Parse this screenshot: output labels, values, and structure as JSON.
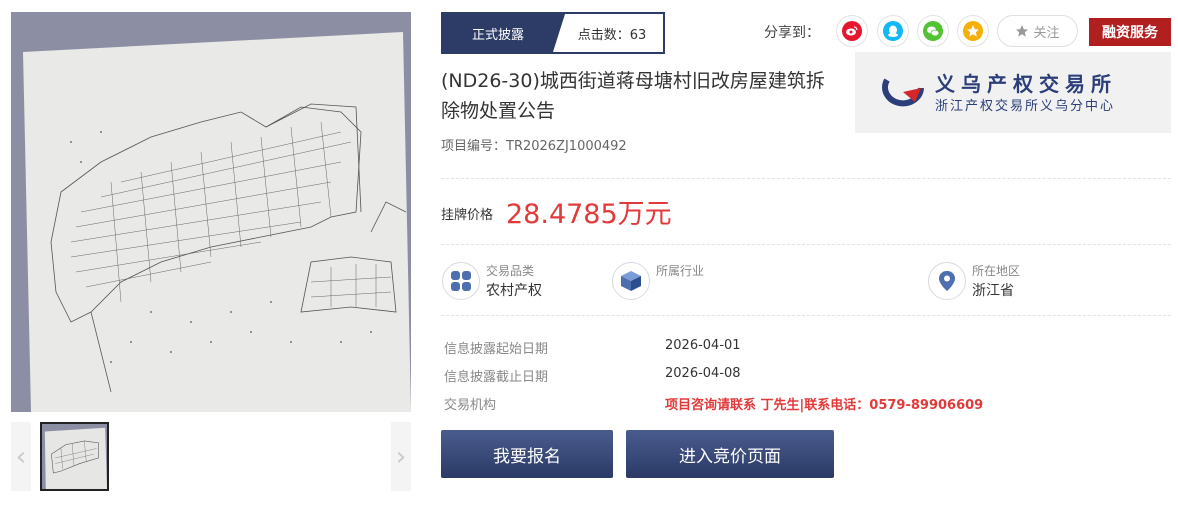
{
  "status": {
    "label": "正式披露",
    "clicks": "点击数：63"
  },
  "share": {
    "label": "分享到：",
    "icons": [
      {
        "name": "weibo-icon",
        "color": "#e6162d",
        "glyph": "微"
      },
      {
        "name": "qq-icon",
        "color": "#12b7f5",
        "glyph": "Q"
      },
      {
        "name": "wechat-icon",
        "color": "#51c332",
        "glyph": "微"
      },
      {
        "name": "qzone-icon",
        "color": "#f5b00b",
        "glyph": "★"
      }
    ],
    "follow": "关注"
  },
  "finance_button": "融资服务",
  "title": "(ND26-30)城西街道蒋母塘村旧改房屋建筑拆除物处置公告",
  "project_no": "项目编号：TR2026ZJ1000492",
  "logo": {
    "name": "义乌产权交易所",
    "sub": "浙江产权交易所义乌分中心"
  },
  "price": {
    "label": "挂牌价格",
    "value": "28.4785万元"
  },
  "info": {
    "category": {
      "key": "交易品类",
      "value": "农村产权"
    },
    "industry": {
      "key": "所属行业",
      "value": ""
    },
    "region": {
      "key": "所在地区",
      "value": "浙江省"
    }
  },
  "details": {
    "start": {
      "key": "信息披露起始日期",
      "value": "2026-04-01"
    },
    "end": {
      "key": "信息披露截止日期",
      "value": "2026-04-08"
    },
    "agency": {
      "key": "交易机构",
      "value": "项目咨询请联系 丁先生|联系电话：0579-89906609"
    }
  },
  "actions": {
    "signup": "我要报名",
    "bidding": "进入竞价页面"
  },
  "colors": {
    "brand": "#2c3c66",
    "price": "#e23a3a",
    "finance": "#b11f1f"
  }
}
